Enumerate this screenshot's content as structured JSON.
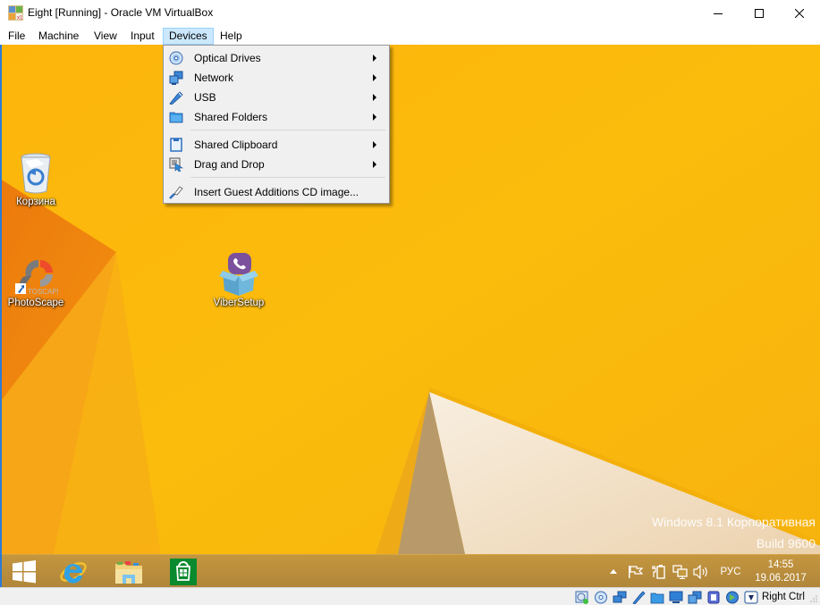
{
  "window": {
    "title": "Eight [Running] - Oracle VM VirtualBox",
    "controls": {
      "minimize": "minimize",
      "maximize": "maximize",
      "close": "close"
    }
  },
  "menubar": {
    "items": [
      {
        "label": "File"
      },
      {
        "label": "Machine"
      },
      {
        "label": "View"
      },
      {
        "label": "Input"
      },
      {
        "label": "Devices",
        "active": true
      },
      {
        "label": "Help"
      }
    ]
  },
  "devices_menu": {
    "items": [
      {
        "label": "Optical Drives",
        "icon": "optical-drive-icon",
        "submenu": true
      },
      {
        "label": "Network",
        "icon": "network-icon",
        "submenu": true
      },
      {
        "label": "USB",
        "icon": "usb-icon",
        "submenu": true
      },
      {
        "label": "Shared Folders",
        "icon": "shared-folder-icon",
        "submenu": true
      },
      {
        "label": "Shared Clipboard",
        "icon": "clipboard-icon",
        "submenu": true
      },
      {
        "label": "Drag and Drop",
        "icon": "drag-drop-icon",
        "submenu": true
      },
      {
        "label": "Insert Guest Additions CD image...",
        "icon": "guest-additions-icon",
        "submenu": false
      }
    ]
  },
  "desktop": {
    "icons": [
      {
        "label": "Корзина",
        "icon": "recycle-bin-icon"
      },
      {
        "label": "PhotoScape",
        "icon": "photoscape-icon",
        "shortcut": true
      },
      {
        "label": "ViberSetup",
        "icon": "viber-setup-icon"
      }
    ],
    "watermark": {
      "line1": "Windows 8.1 Корпоративная",
      "line2": "Build 9600"
    }
  },
  "taskbar": {
    "pinned": [
      {
        "name": "start",
        "icon": "windows-logo-icon"
      },
      {
        "name": "internet-explorer",
        "icon": "internet-explorer-icon"
      },
      {
        "name": "file-explorer",
        "icon": "file-explorer-icon"
      },
      {
        "name": "store",
        "icon": "store-icon"
      }
    ],
    "tray": {
      "language": "РУС",
      "time": "14:55",
      "date": "19.06.2017"
    }
  },
  "statusbar": {
    "icons": [
      "hard-disk-icon",
      "optical-drive-icon",
      "network-icon",
      "usb-icon",
      "shared-folder-icon",
      "display-icon",
      "video-capture-icon",
      "cpu-icon",
      "mouse-integration-icon",
      "keyboard-capture-icon"
    ],
    "host_key": "Right Ctrl"
  },
  "colors": {
    "menu_highlight": "#cce8ff",
    "desktop_bg": "#fbb40a",
    "taskbar": "#b88c3b"
  }
}
